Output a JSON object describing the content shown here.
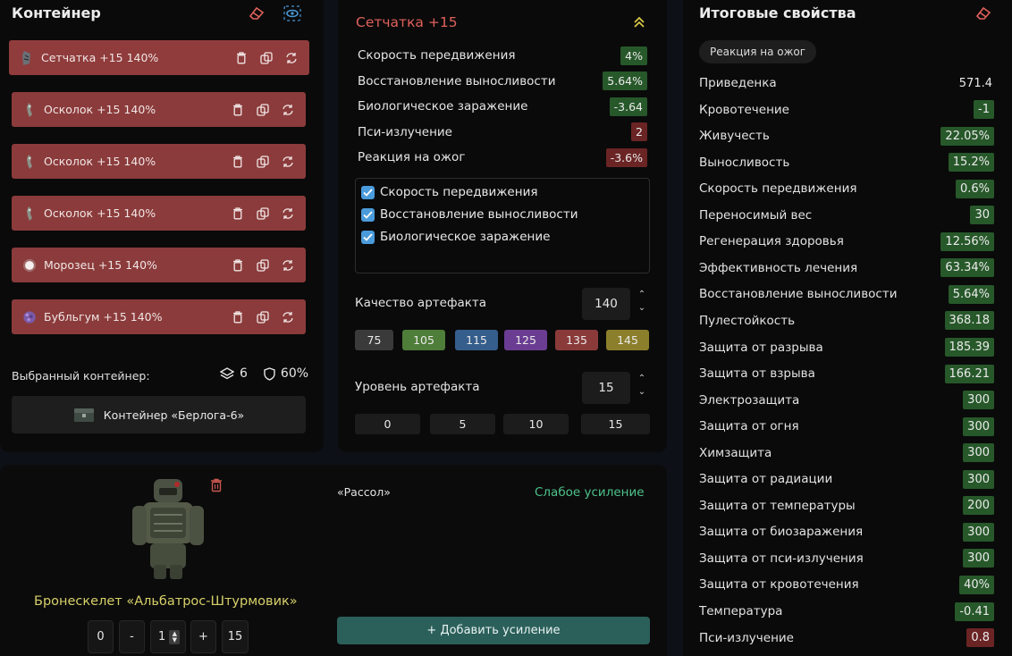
{
  "container": {
    "title": "Контейнер",
    "items": [
      {
        "name": "Сетчатка +15 140%",
        "icon": "setchatka-artifact-icon"
      },
      {
        "name": "Осколок +15 140%",
        "icon": "oskolok-artifact-icon"
      },
      {
        "name": "Осколок +15 140%",
        "icon": "oskolok-artifact-icon"
      },
      {
        "name": "Осколок +15 140%",
        "icon": "oskolok-artifact-icon"
      },
      {
        "name": "Морозец +15 140%",
        "icon": "morozets-artifact-icon"
      },
      {
        "name": "Бубльгум +15 140%",
        "icon": "bublgum-artifact-icon"
      }
    ],
    "selected_label": "Выбранный контейнер:",
    "slots": "6",
    "protection": "60%",
    "container_name": "Контейнер «Берлога-6»"
  },
  "artifact": {
    "title": "Сетчатка +15",
    "stats": [
      {
        "name": "Скорость передвижения",
        "value": "4%",
        "kind": "pos"
      },
      {
        "name": "Восстановление выносливости",
        "value": "5.64%",
        "kind": "pos"
      },
      {
        "name": "Биологическое заражение",
        "value": "-3.64",
        "kind": "pos"
      },
      {
        "name": "Пси-излучение",
        "value": "2",
        "kind": "neg"
      },
      {
        "name": "Реакция на ожог",
        "value": "-3.6%",
        "kind": "neg"
      }
    ],
    "checked": [
      "Скорость передвижения",
      "Восстановление выносливости",
      "Биологическое заражение"
    ],
    "quality_label": "Качество артефакта",
    "quality_value": "140",
    "quality_options": [
      {
        "label": "75",
        "color": "#3a3a3a"
      },
      {
        "label": "105",
        "color": "#4f7d3a"
      },
      {
        "label": "115",
        "color": "#355e8c"
      },
      {
        "label": "125",
        "color": "#6a3d92"
      },
      {
        "label": "135",
        "color": "#8b3a3a"
      },
      {
        "label": "145",
        "color": "#8c7f2c"
      }
    ],
    "level_label": "Уровень артефакта",
    "level_value": "15",
    "level_options": [
      "0",
      "5",
      "10",
      "15"
    ]
  },
  "armor": {
    "name": "Бронескелет «Альбатрос-Штурмовик»",
    "min": "0",
    "minus": "-",
    "value": "1",
    "plus": "+",
    "max": "15",
    "boost_name": "«Рассол»",
    "boost_level": "Слабое усиление",
    "add_boost": "+ Добавить усиление"
  },
  "summary": {
    "title": "Итоговые свойства",
    "chip": "Реакция на ожог",
    "rows": [
      {
        "name": "Приведенка",
        "value": "571.4",
        "kind": "plain"
      },
      {
        "name": "Кровотечение",
        "value": "-1",
        "kind": "pos"
      },
      {
        "name": "Живучесть",
        "value": "22.05%",
        "kind": "pos"
      },
      {
        "name": "Выносливость",
        "value": "15.2%",
        "kind": "pos"
      },
      {
        "name": "Скорость передвижения",
        "value": "0.6%",
        "kind": "pos"
      },
      {
        "name": "Переносимый вес",
        "value": "30",
        "kind": "pos"
      },
      {
        "name": "Регенерация здоровья",
        "value": "12.56%",
        "kind": "pos"
      },
      {
        "name": "Эффективность лечения",
        "value": "63.34%",
        "kind": "pos"
      },
      {
        "name": "Восстановление выносливости",
        "value": "5.64%",
        "kind": "pos"
      },
      {
        "name": "Пулестойкость",
        "value": "368.18",
        "kind": "pos"
      },
      {
        "name": "Защита от разрыва",
        "value": "185.39",
        "kind": "pos"
      },
      {
        "name": "Защита от взрыва",
        "value": "166.21",
        "kind": "pos"
      },
      {
        "name": "Электрозащита",
        "value": "300",
        "kind": "pos"
      },
      {
        "name": "Защита от огня",
        "value": "300",
        "kind": "pos"
      },
      {
        "name": "Химзащита",
        "value": "300",
        "kind": "pos"
      },
      {
        "name": "Защита от радиации",
        "value": "300",
        "kind": "pos"
      },
      {
        "name": "Защита от температуры",
        "value": "200",
        "kind": "pos"
      },
      {
        "name": "Защита от биозаражения",
        "value": "300",
        "kind": "pos"
      },
      {
        "name": "Защита от пси-излучения",
        "value": "300",
        "kind": "pos"
      },
      {
        "name": "Защита от кровотечения",
        "value": "40%",
        "kind": "pos"
      },
      {
        "name": "Температура",
        "value": "-0.41",
        "kind": "pos"
      },
      {
        "name": "Пси-излучение",
        "value": "0.8",
        "kind": "neg"
      }
    ]
  },
  "colors": {
    "row_red": "#8b3b3b",
    "positive": "#27582a",
    "negative": "#6b2424",
    "accent_title": "#e0615c",
    "boost_green": "#4dc28b",
    "suit_name": "#d7d06a",
    "add_button": "#2b5f5a",
    "eraser": "#e0615c",
    "eye": "#4a9bdb"
  }
}
